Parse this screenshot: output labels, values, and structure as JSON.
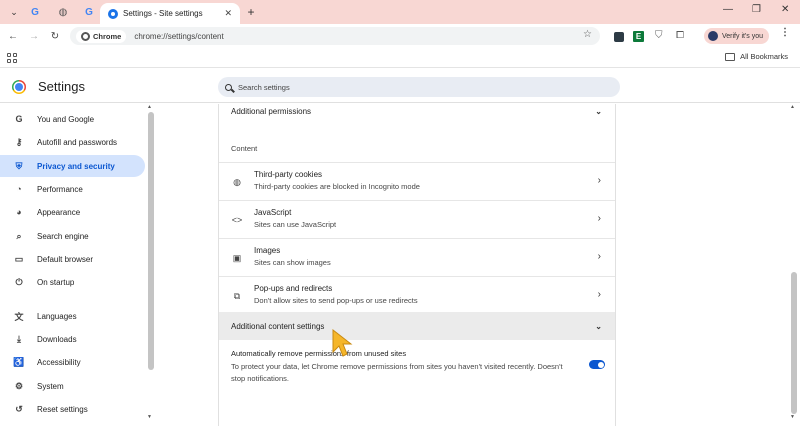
{
  "browser": {
    "active_tab_title": "Settings - Site settings",
    "new_tab_symbol": "+",
    "close_symbol": "✕",
    "minimize_symbol": "—",
    "restore_symbol": "❐",
    "window_close_symbol": "✕",
    "chip_label": "Chrome",
    "url": "chrome://settings/content",
    "profile_label": "Verify it's you",
    "all_bookmarks": "All Bookmarks",
    "extension_e_label": "E"
  },
  "settings": {
    "title": "Settings",
    "search_placeholder": "Search settings"
  },
  "sidebar": {
    "items": [
      {
        "label": "You and Google",
        "icon": "google-g-icon",
        "glyph": "G"
      },
      {
        "label": "Autofill and passwords",
        "icon": "key-icon",
        "glyph": "⚷"
      },
      {
        "label": "Privacy and security",
        "icon": "shield-icon",
        "glyph": "⛨"
      },
      {
        "label": "Performance",
        "icon": "speedometer-icon",
        "glyph": "◔"
      },
      {
        "label": "Appearance",
        "icon": "palette-icon",
        "glyph": "◕"
      },
      {
        "label": "Search engine",
        "icon": "search-icon",
        "glyph": "⌕"
      },
      {
        "label": "Default browser",
        "icon": "browser-icon",
        "glyph": "▭"
      },
      {
        "label": "On startup",
        "icon": "power-icon",
        "glyph": "⏻"
      },
      {
        "label": "Languages",
        "icon": "translate-icon",
        "glyph": "文"
      },
      {
        "label": "Downloads",
        "icon": "download-icon",
        "glyph": "⤓"
      },
      {
        "label": "Accessibility",
        "icon": "accessibility-icon",
        "glyph": "♿"
      },
      {
        "label": "System",
        "icon": "wrench-icon",
        "glyph": "⚙"
      },
      {
        "label": "Reset settings",
        "icon": "reset-icon",
        "glyph": "↺"
      }
    ]
  },
  "main": {
    "additional_permissions": "Additional permissions",
    "content_label": "Content",
    "rows": [
      {
        "title": "Third-party cookies",
        "subtitle": "Third-party cookies are blocked in Incognito mode",
        "glyph": "◍"
      },
      {
        "title": "JavaScript",
        "subtitle": "Sites can use JavaScript",
        "glyph": "<>"
      },
      {
        "title": "Images",
        "subtitle": "Sites can show images",
        "glyph": "▣"
      },
      {
        "title": "Pop-ups and redirects",
        "subtitle": "Don't allow sites to send pop-ups or use redirects",
        "glyph": "⧉"
      }
    ],
    "additional_content_settings": "Additional content settings",
    "auto_remove_title": "Automatically remove permissions from unused sites",
    "auto_remove_desc": "To protect your data, let Chrome remove permissions from sites you haven't visited recently. Doesn't stop notifications.",
    "auto_remove_enabled": true,
    "chevron_glyph": "⌄",
    "arrow_glyph": "›"
  },
  "colors": {
    "tab_strip": "#f8d7d3",
    "accent": "#0b57d0",
    "active_nav_bg": "#d3e3fd",
    "cursor": "#f5b62a"
  }
}
